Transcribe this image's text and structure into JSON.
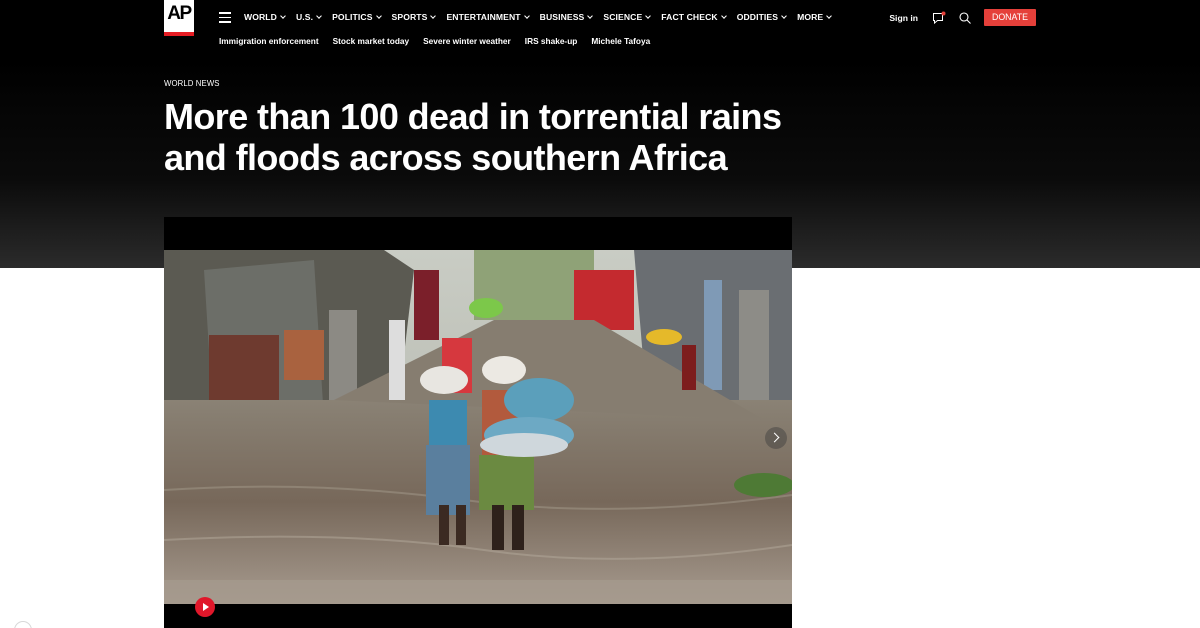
{
  "brand": {
    "logo_text": "AP"
  },
  "nav": {
    "items": [
      {
        "label": "WORLD"
      },
      {
        "label": "U.S."
      },
      {
        "label": "POLITICS"
      },
      {
        "label": "SPORTS"
      },
      {
        "label": "ENTERTAINMENT"
      },
      {
        "label": "BUSINESS"
      },
      {
        "label": "SCIENCE"
      },
      {
        "label": "FACT CHECK"
      },
      {
        "label": "ODDITIES"
      },
      {
        "label": "MORE"
      }
    ],
    "trending": [
      {
        "label": "Immigration enforcement"
      },
      {
        "label": "Stock market today"
      },
      {
        "label": "Severe winter weather"
      },
      {
        "label": "IRS shake-up"
      },
      {
        "label": "Michele Tafoya"
      }
    ]
  },
  "header_right": {
    "signin_label": "Sign in",
    "donate_label": "DONATE",
    "icons": [
      "chat-notification-icon",
      "search-icon"
    ]
  },
  "article": {
    "section": "WORLD NEWS",
    "headline": "More than 100 dead in torrential rains and floods across southern Africa"
  },
  "media": {
    "icons": [
      "play-icon",
      "chevron-right-icon"
    ]
  },
  "colors": {
    "accent_red": "#e5403a",
    "logo_red": "#e51c23",
    "header_bg": "#000000"
  }
}
